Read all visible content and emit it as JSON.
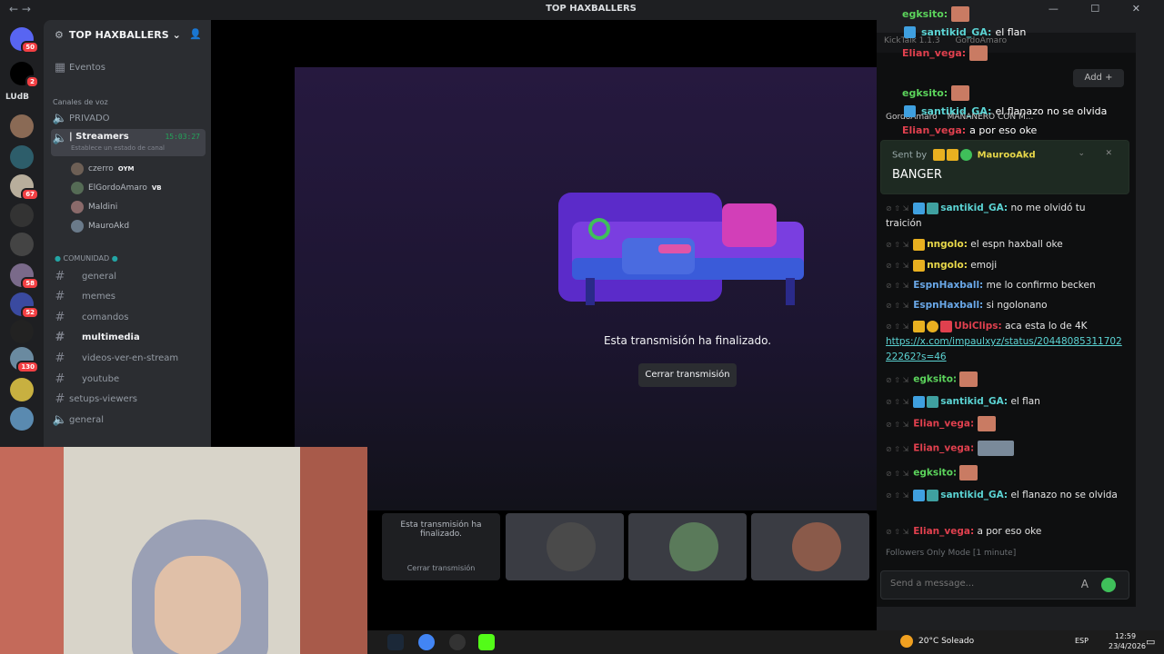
{
  "window": {
    "title": "TOP HAXBALLERS",
    "nav": "←  →"
  },
  "servers": {
    "label_ludb": "LUdB",
    "badges": [
      "50",
      "2",
      "67",
      "58",
      "52",
      "130"
    ]
  },
  "guild": {
    "name": "TOP HAXBALLERS",
    "events": "Eventos"
  },
  "voice": {
    "category": "Canales de voz",
    "private": "PRIVADO",
    "streamers": "| Streamers",
    "streamers_time": "15:03:27",
    "status_hint": "Establece un estado de canal",
    "users": [
      {
        "name": "czerro",
        "tag": "OYM"
      },
      {
        "name": "ElGordoAmaro",
        "tag": "VB"
      },
      {
        "name": "Maldini",
        "tag": ""
      },
      {
        "name": "MauroAkd",
        "tag": ""
      }
    ]
  },
  "community": {
    "category": "COMUNIDAD",
    "channels": [
      "general",
      "memes",
      "comandos",
      "multimedia",
      "videos-ver-en-stream",
      "youtube",
      "setups-viewers",
      "general"
    ]
  },
  "stream": {
    "ended_text": "Esta transmisión ha finalizado.",
    "close_label": "Cerrar transmisión",
    "thumb_ended": "Esta transmisión ha finalizado.",
    "thumb_close": "Cerrar transmisión"
  },
  "kick": {
    "app": "KickTalk 1.1.3",
    "account": "GordoAmaro",
    "add_label": "Add",
    "channel_title": "MAÑANERO CON M...",
    "pinned": {
      "sent_by": "Sent by",
      "user": "MaurooAkd",
      "message": "BANGER"
    },
    "overlay": [
      {
        "user": "egksito:",
        "text": "",
        "color": "#5bd35b"
      },
      {
        "user": "santikid_GA:",
        "text": "el flan",
        "color": "#5bd3d3"
      },
      {
        "user": "Elian_vega:",
        "text": "",
        "color": "#e0404e"
      },
      {
        "user": "egksito:",
        "text": "",
        "color": "#5bd35b"
      },
      {
        "user": "santikid_GA:",
        "text": "el flanazo no se olvida",
        "color": "#5bd3d3"
      },
      {
        "user": "Elian_vega:",
        "text": "a por eso oke",
        "color": "#e0404e"
      }
    ],
    "messages": [
      {
        "user": "santikid_GA:",
        "text": "no me olvidó tu traición",
        "color": "#5bd3d3"
      },
      {
        "user": "nngolo:",
        "text": "el espn haxball oke",
        "color": "#e8d84a"
      },
      {
        "user": "nngolo:",
        "text": "emoji",
        "color": "#e8d84a"
      },
      {
        "user": "EspnHaxball:",
        "text": "me lo confirmo becken",
        "color": "#6aa8e8"
      },
      {
        "user": "EspnHaxball:",
        "text": "si ngolonano",
        "color": "#6aa8e8"
      },
      {
        "user": "UbiClips:",
        "text": "aca esta lo de 4K",
        "color": "#e0404e"
      },
      {
        "user": "",
        "text": "https://x.com/impaulxyz/status/2044808531170222262?s=46",
        "color": "#5bd3d3"
      },
      {
        "user": "egksito:",
        "text": "",
        "color": "#5bd35b"
      },
      {
        "user": "santikid_GA:",
        "text": "el flan",
        "color": "#5bd3d3"
      },
      {
        "user": "Elian_vega:",
        "text": "",
        "color": "#e0404e"
      },
      {
        "user": "Elian_vega:",
        "text": "",
        "color": "#e0404e"
      },
      {
        "user": "egksito:",
        "text": "",
        "color": "#5bd35b"
      },
      {
        "user": "santikid_GA:",
        "text": "el flanazo no se olvida",
        "color": "#5bd3d3"
      },
      {
        "user": "Elian_vega:",
        "text": "a por eso oke",
        "color": "#e0404e"
      }
    ],
    "followers_mode": "Followers Only Mode [1 minute]",
    "input_placeholder": "Send a message..."
  },
  "taskbar": {
    "weather": "20°C Soleado",
    "lang": "ESP",
    "time": "12:59",
    "date": "23/4/2026"
  }
}
